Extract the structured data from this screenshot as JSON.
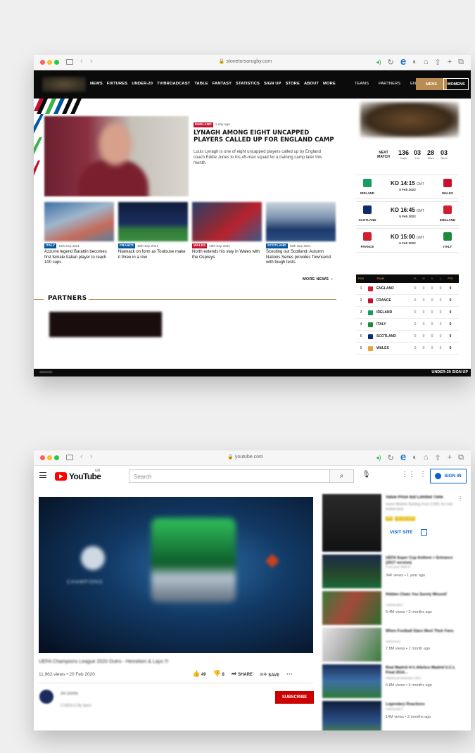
{
  "win1": {
    "url": "stonetorsorugby.com",
    "nav": {
      "items": [
        "NEWS",
        "FIXTURES",
        "UNDER-20",
        "TV/BROADCAST",
        "TABLE",
        "FANTASY",
        "STATISTICS",
        "SIGN UP",
        "STORE",
        "ABOUT",
        "MORE"
      ],
      "teams": "TEAMS",
      "partners": "PARTNERS",
      "lang": "EN",
      "mens": "MENS",
      "womens": "WOMENS"
    },
    "hero": {
      "tag": "ENGLAND",
      "time": "1 day ago",
      "title": "LYNAGH AMONG EIGHT UNCAPPED PLAYERS CALLED UP FOR ENGLAND CAMP",
      "desc": "Louis Lynagh is one of eight uncapped players called up by England coach Eddie Jones to his 45-man squad for a training camp later this month."
    },
    "cards": [
      {
        "tag": "ITALY",
        "date": "15th Sep 2021",
        "title": "Azzurre legend Barattin becomes first female Italian player to reach 100 caps"
      },
      {
        "tag": "FRANCE",
        "date": "15th Sep 2021",
        "title": "Ntamack on form as Toulouse make it three in a row"
      },
      {
        "tag": "WALES",
        "date": "16th Sep 2021",
        "title": "North extends his stay in Wales with the Ospreys"
      },
      {
        "tag": "SCOTLAND",
        "date": "15th Sep 2021",
        "title": "Scouting out Scotland: Autumn Nations Series provides Townsend with tough tests"
      }
    ],
    "more_news": "MORE NEWS",
    "partners_title": "PARTNERS",
    "next_match": {
      "label": "NEXT MATCH",
      "days": "136",
      "hrs": "03",
      "mins": "28",
      "secs": "03",
      "u_days": "Days",
      "u_hrs": "Hrs",
      "u_mins": "Mins",
      "u_secs": "Secs"
    },
    "fixtures": [
      {
        "home": "IRELAND",
        "ko": "KO 14:15",
        "tz": "GMT",
        "date": "5 Feb 2022",
        "away": "WALES"
      },
      {
        "home": "SCOTLAND",
        "ko": "KO 16:45",
        "tz": "GMT",
        "date": "5 Feb 2022",
        "away": "ENGLAND"
      },
      {
        "home": "FRANCE",
        "ko": "KO 15:00",
        "tz": "GMT",
        "date": "6 Feb 2022",
        "away": "ITALY"
      }
    ],
    "table": {
      "headers": {
        "pos": "POS",
        "team": "TEAM",
        "pl": "PL",
        "w": "W",
        "d": "D",
        "l": "L",
        "pts": "PTS"
      },
      "rows": [
        {
          "pos": "1",
          "team": "ENGLAND",
          "pl": "0",
          "w": "0",
          "d": "0",
          "l": "0",
          "pts": "0"
        },
        {
          "pos": "2",
          "team": "FRANCE",
          "pl": "0",
          "w": "0",
          "d": "0",
          "l": "0",
          "pts": "0"
        },
        {
          "pos": "3",
          "team": "IRELAND",
          "pl": "0",
          "w": "0",
          "d": "0",
          "l": "0",
          "pts": "0"
        },
        {
          "pos": "4",
          "team": "ITALY",
          "pl": "0",
          "w": "0",
          "d": "0",
          "l": "0",
          "pts": "0"
        },
        {
          "pos": "5",
          "team": "SCOTLAND",
          "pl": "0",
          "w": "0",
          "d": "0",
          "l": "0",
          "pts": "0"
        },
        {
          "pos": "6",
          "team": "WALES",
          "pl": "0",
          "w": "0",
          "d": "0",
          "l": "0",
          "pts": "0"
        }
      ]
    },
    "footer_right": "UNDER-20   SIGN UP"
  },
  "win2": {
    "url": "youtube.com",
    "logo_word": "YouTube",
    "region": "GB",
    "search_placeholder": "Search",
    "sign_in": "SIGN IN",
    "video": {
      "title": "UEFA Champions League 2020 Outro - Heineken & Lays !!!",
      "stats": "11,962 views • 20 Feb 2020",
      "likes": "49",
      "dislikes": "8",
      "share": "SHARE",
      "save": "SAVE",
      "channel": "All Grime",
      "channel_subs": "0 UEFA Cl By Sport",
      "subscribe": "SUBSCRIBE"
    },
    "ad": {
      "title": "Value Price but Limited Time",
      "desc": "Some Models Starting From 2,999, for only limited time.",
      "badge": "Ad",
      "domain": "uk.msi.com",
      "visit": "VISIT SITE"
    },
    "related": [
      {
        "title": "UEFA Super Cup Anthem + Entrance (2017 version)",
        "channel": "Foot your Ball III",
        "views": "34K views • 1 year ago"
      },
      {
        "title": "Hidden Chats You Surely Missed!",
        "channel": "AshStudio7",
        "views": "5.4M views • 2 months ago"
      },
      {
        "title": "When Football Stars Meet Their Fans",
        "channel": "ArtSoccer",
        "views": "7.8M views • 1 month ago"
      },
      {
        "title": "Real Madrid 4+1 Atletico Madrid U.C.L Final 2014...",
        "channel": "Historical Matches HD1",
        "views": "6.8M views • 5 months ago"
      },
      {
        "title": "Legendary Reactions",
        "channel": "AshStudio7",
        "views": "14M views • 2 months ago"
      }
    ]
  }
}
